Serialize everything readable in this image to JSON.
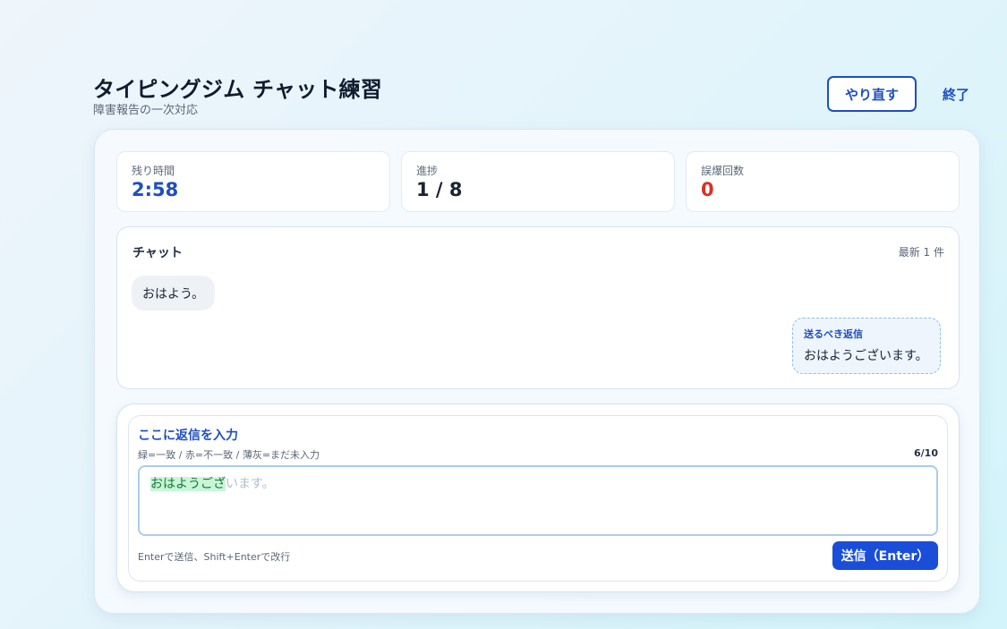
{
  "header": {
    "title": "タイピングジム チャット練習",
    "subtitle": "障害報告の一次対応",
    "retry_label": "やり直す",
    "end_label": "終了"
  },
  "stats": {
    "time": {
      "label": "残り時間",
      "value": "2:58",
      "color": "#1e4fbf"
    },
    "progress": {
      "label": "進捗",
      "value": "1 / 8",
      "color": "#1a2433"
    },
    "errors": {
      "label": "誤爆回数",
      "value": "0",
      "color": "#d93025"
    }
  },
  "chat": {
    "title": "チャット",
    "count": "最新 1 件",
    "incoming": "おはよう。",
    "expected_hint": "送るべき返信",
    "expected_text": "おはようございます。"
  },
  "input": {
    "title": "ここに返信を入力",
    "legend": "緑=一致 / 赤=不一致 / 薄灰=まだ未入力",
    "progress": "6/10",
    "typed": "おはようござ",
    "remaining": "います。",
    "footer": "Enterで送信、Shift+Enterで改行",
    "send_label": "送信（Enter）"
  },
  "colors": {
    "accent": "#1e4fbf",
    "match": "#157a37",
    "error": "#d93025"
  }
}
